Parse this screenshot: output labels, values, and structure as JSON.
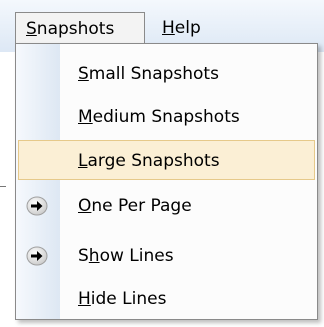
{
  "menubar": {
    "items": [
      {
        "label": "Snapshots",
        "accel": "S",
        "rest": "napshots"
      },
      {
        "label": "Help",
        "accel": "H",
        "rest": "elp"
      }
    ]
  },
  "menu": {
    "items": [
      {
        "label": "Small Snapshots",
        "accel": "S",
        "rest": "mall Snapshots"
      },
      {
        "label": "Medium Snapshots",
        "accel": "M",
        "rest": "edium Snapshots"
      },
      {
        "label": "Large Snapshots",
        "accel": "L",
        "rest": "arge Snapshots",
        "selected": true
      },
      {
        "label": "One Per Page",
        "accel": "O",
        "rest": "ne Per Page",
        "icon": "right-arrow-bullet-icon"
      },
      {
        "label": "Show Lines",
        "pre": "S",
        "accel": "h",
        "rest": "ow Lines",
        "icon": "right-arrow-bullet-icon"
      },
      {
        "label": "Hide Lines",
        "accel": "H",
        "rest": "ide Lines"
      }
    ]
  },
  "colors": {
    "menubar_gradient_top": "#f4f8fd",
    "menubar_gradient_bottom": "#dde8f5",
    "selection_background": "#fbefd5",
    "selection_border": "#e6c98a",
    "menu_border": "#8a8a8a"
  }
}
